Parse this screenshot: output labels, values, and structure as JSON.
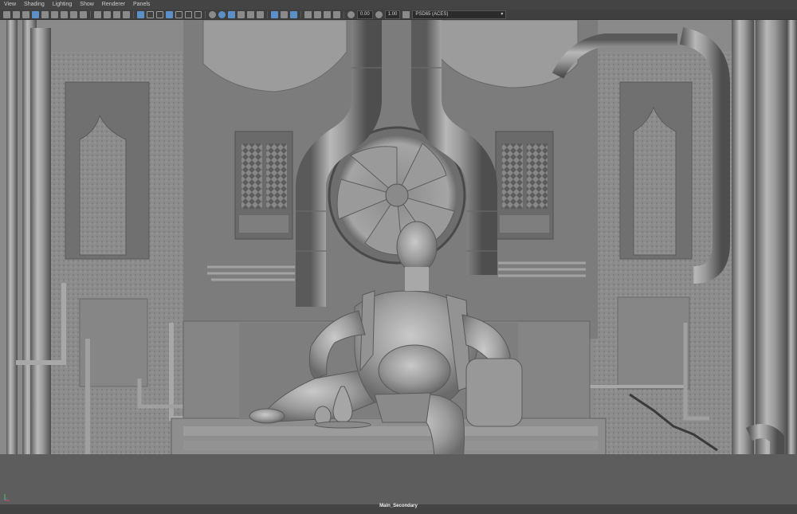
{
  "menu": {
    "items": [
      "View",
      "Shading",
      "Lighting",
      "Show",
      "Renderer",
      "Panels"
    ]
  },
  "toolbar": {
    "exposure_value": "0.00",
    "gamma_value": "1.00",
    "color_space": "PSD65 (ACES)"
  },
  "viewport": {
    "panel_label": "Main_Secondary"
  },
  "colors": {
    "bg": "#444444",
    "viewport": "#5d5d5d",
    "accent": "#5a8fc7"
  }
}
